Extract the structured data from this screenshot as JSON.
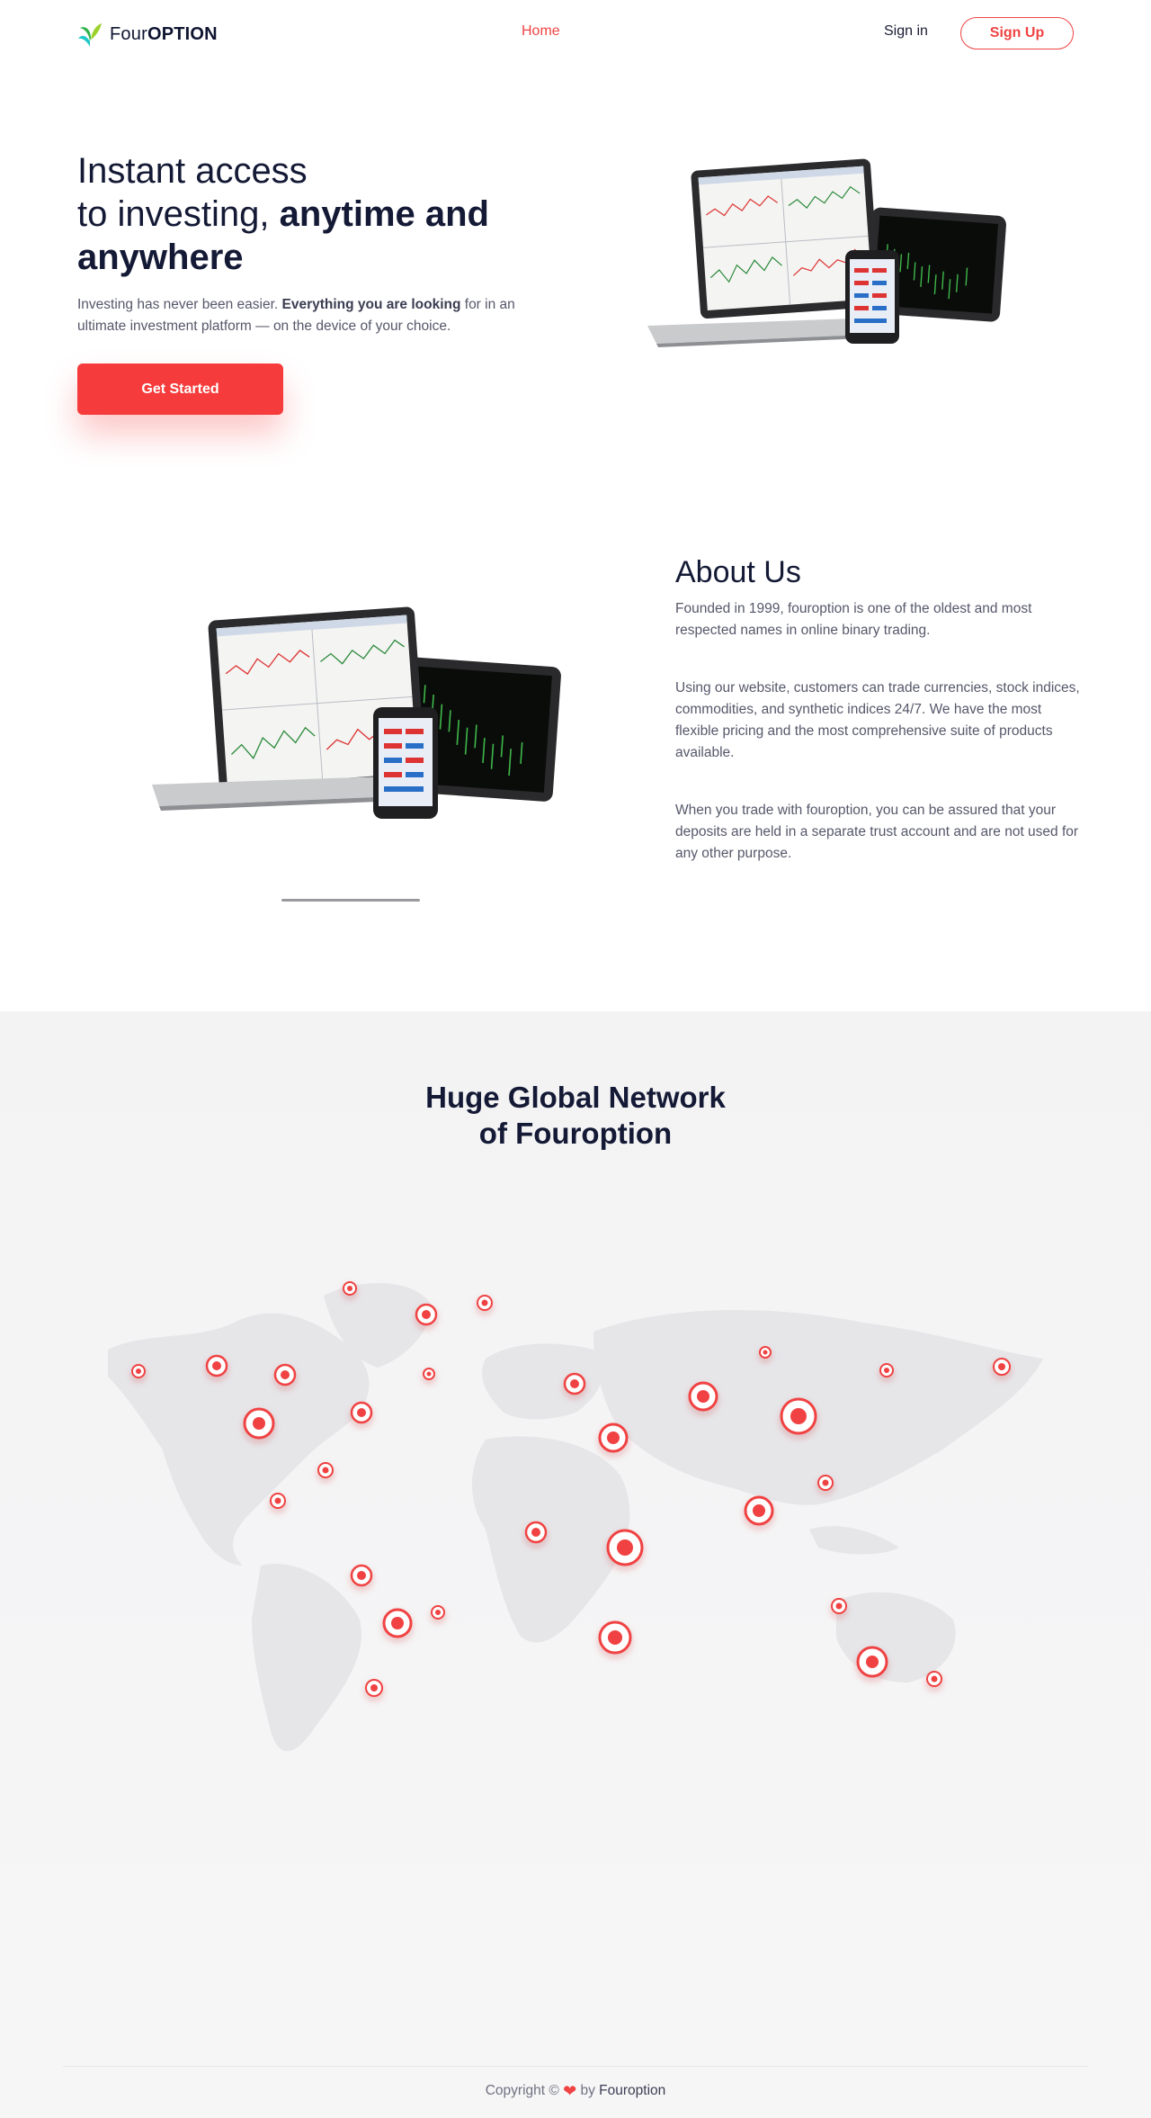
{
  "nav": {
    "brand_light": "Four",
    "brand_bold": "OPTION",
    "home": "Home",
    "signin": "Sign in",
    "signup": "Sign Up"
  },
  "hero": {
    "title_line1": "Instant access",
    "title_line2_light": "to investing, ",
    "title_line2_bold": "anytime and",
    "title_line3": "anywhere",
    "desc_start": "Investing has never been easier. ",
    "desc_bold": "Everything you are looking",
    "desc_end": " for in an ultimate investment platform — on the device of your choice.",
    "cta": "Get Started"
  },
  "about": {
    "title": "About Us",
    "p1": "Founded in 1999, fouroption is one of the oldest and most respected names in online binary trading.",
    "p2": "Using our website, customers can trade currencies, stock indices, commodities, and synthetic indices 24/7. We have the most flexible pricing and the most comprehensive suite of products available.",
    "p3": "When you trade with fouroption, you can be assured that your deposits are held in a separate trust account and are not used for any other purpose."
  },
  "network": {
    "title_line1": "Huge Global Network",
    "title_line2": "of Fouroption"
  },
  "footer": {
    "copyright": "Copyright © ",
    "by": " by ",
    "brand": "Fouroption"
  },
  "icons": {
    "logo": "leaf-logo-icon",
    "heart": "heart-icon",
    "map_marker": "location-marker-icon"
  },
  "colors": {
    "accent": "#f04343",
    "button": "#f53b3b",
    "heading": "#141a35",
    "body_text": "#56586a",
    "section_bg": "#f3f3f4"
  }
}
